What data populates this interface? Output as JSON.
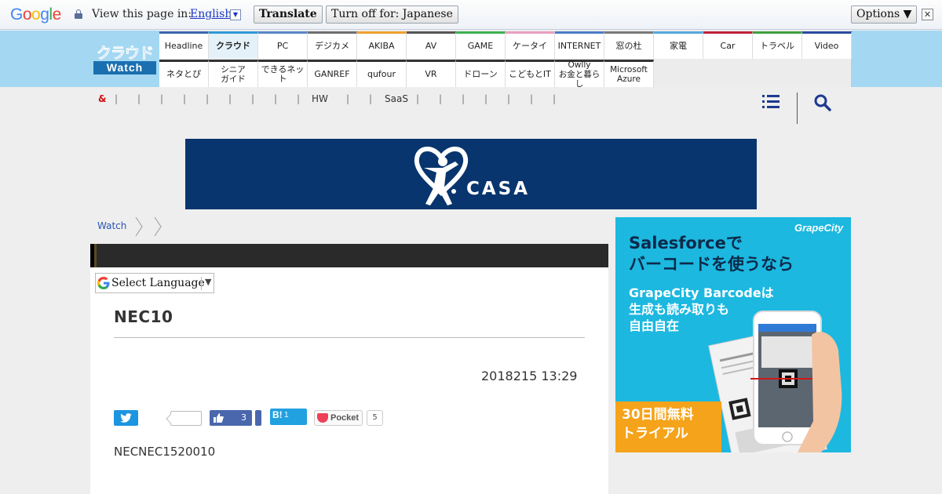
{
  "translate_bar": {
    "logo": "Google",
    "prompt": "View this page in:",
    "language": "English",
    "translate_label": "Translate",
    "turn_off_label": "Turn off for: Japanese",
    "options_label": "Options ▼",
    "close_label": "✕"
  },
  "site": {
    "logo_top": "クラウド",
    "logo_bottom": "Watch"
  },
  "nav": {
    "row1": [
      "Headline",
      "クラウド",
      "PC",
      "デジカメ",
      "AKIBA",
      "AV",
      "GAME",
      "ケータイ",
      "INTERNET",
      "窓の杜",
      "家電",
      "Car",
      "トラベル",
      "Video"
    ],
    "row1_colors": [
      "#3d64b0",
      "#2f98d8",
      "#5a86c8",
      "#6e6e6e",
      "#f0a030",
      "#555555",
      "#3db050",
      "#e8a0c0",
      "#4a7cc8",
      "#7a7a7a",
      "#55a8dd",
      "#c0223a",
      "#40a040",
      "#2a4aa0"
    ],
    "row1_active": "クラウド",
    "row2": [
      "ネタとぴ",
      "シニア\nガイド",
      "できるネット",
      "GANREF",
      "qufour",
      "VR",
      "ドローン",
      "こどもとIT",
      "Owlly\nお金と暮らし",
      "Microsoft\nAzure"
    ]
  },
  "subnav": {
    "amp": "&",
    "labels": [
      "HW",
      "SaaS"
    ]
  },
  "banner": {
    "text": "CASA"
  },
  "breadcrumb": {
    "home": "Watch"
  },
  "translate_widget": {
    "label": "Select Language",
    "arrow": "▼"
  },
  "article": {
    "title": "NEC10",
    "date": "2018215 13:29",
    "body": "NECNEC1520010"
  },
  "share": {
    "facebook_count": "3",
    "hatena_label": "B!",
    "hatena_count": "1",
    "pocket_label": "Pocket",
    "pocket_count": "5"
  },
  "side_ad": {
    "brand": "GrapeCity",
    "headline_line1": "Salesforceで",
    "headline_line2": "バーコードを使うなら",
    "sub_line1": "GrapeCity Barcodeは",
    "sub_line2": "生成も読み取りも",
    "sub_line3": "自由自在",
    "cta_line1": "30日間無料",
    "cta_line2": "トライアル"
  },
  "colors": {
    "header_bg": "#a4d8f2",
    "banner_bg": "#08356e",
    "ad_bg": "#1cb8e0",
    "cta_bg": "#f5a31a",
    "link": "#2a55b8"
  }
}
